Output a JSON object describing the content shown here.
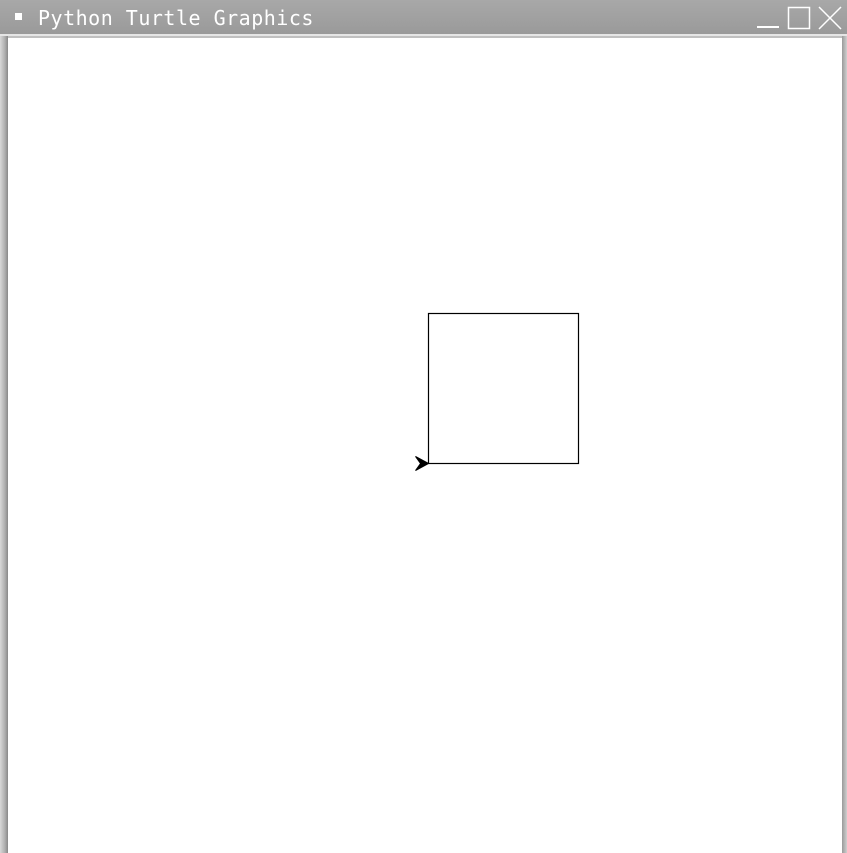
{
  "window": {
    "title": "Python Turtle Graphics",
    "controls": {
      "minimize_icon": "minimize-icon",
      "maximize_icon": "maximize-icon",
      "close_icon": "close-icon"
    }
  },
  "canvas": {
    "background": "#ffffff",
    "pen_color": "#000000",
    "drawing": {
      "shape": "square",
      "side_length": 150
    },
    "turtle": {
      "shape": "arrow",
      "heading": 0,
      "color": "#000000"
    }
  }
}
